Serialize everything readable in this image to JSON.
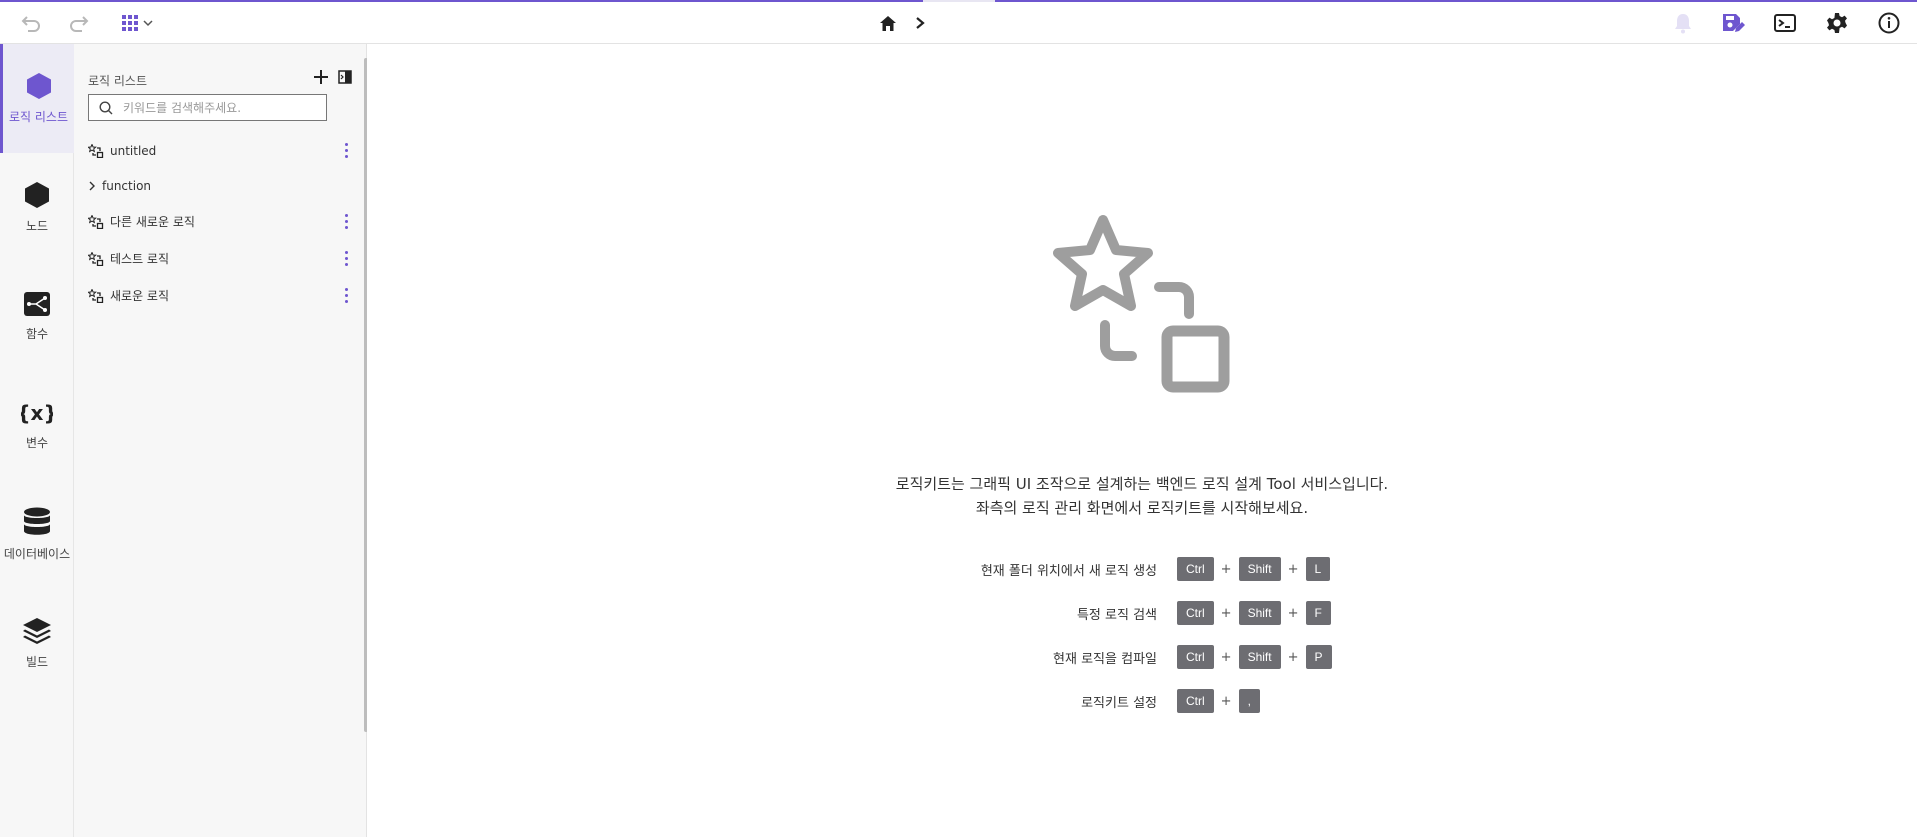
{
  "toolbar": {
    "undo_icon": "undo-icon",
    "redo_icon": "redo-icon",
    "apps_icon": "apps-grid-icon",
    "home_icon": "home-icon",
    "breadcrumb_chevron": "chevron-right-icon",
    "right_icons": [
      "bell-icon",
      "save-edit-icon",
      "terminal-icon",
      "gear-icon",
      "info-icon"
    ]
  },
  "rail": {
    "items": [
      {
        "label": "로직 리스트",
        "icon": "hexagon-outline-icon",
        "active": true
      },
      {
        "label": "노드",
        "icon": "hexagon-icon"
      },
      {
        "label": "함수",
        "icon": "function-flow-icon"
      },
      {
        "label": "변수",
        "icon": "variable-icon"
      },
      {
        "label": "데이터베이스",
        "icon": "database-icon"
      },
      {
        "label": "빌드",
        "icon": "layers-icon"
      }
    ]
  },
  "panel": {
    "title": "로직 리스트",
    "search_placeholder": "키워드를 검색해주세요.",
    "items": [
      {
        "name": "untitled",
        "type": "logic"
      },
      {
        "name": "function",
        "type": "folder"
      },
      {
        "name": "다른 새로운 로직",
        "type": "logic"
      },
      {
        "name": "테스트 로직",
        "type": "logic"
      },
      {
        "name": "새로운 로직",
        "type": "logic"
      }
    ]
  },
  "main": {
    "intro_line1": "로직키트는 그래픽 UI 조작으로 설계하는 백엔드 로직 설계 Tool 서비스입니다.",
    "intro_line2": "좌측의 로직 관리 화면에서 로직키트를 시작해보세요.",
    "shortcuts": [
      {
        "label": "현재 폴더 위치에서 새 로직 생성",
        "keys": [
          "Ctrl",
          "Shift",
          "L"
        ]
      },
      {
        "label": "특정 로직 검색",
        "keys": [
          "Ctrl",
          "Shift",
          "F"
        ]
      },
      {
        "label": "현재 로직을 컴파일",
        "keys": [
          "Ctrl",
          "Shift",
          "P"
        ]
      },
      {
        "label": "로직키트 설정",
        "keys": [
          "Ctrl",
          ","
        ]
      }
    ],
    "plus": "+"
  },
  "colors": {
    "accent": "#6e56cf",
    "key_bg": "#6d6d72",
    "hero_gray": "#9e9e9e"
  }
}
